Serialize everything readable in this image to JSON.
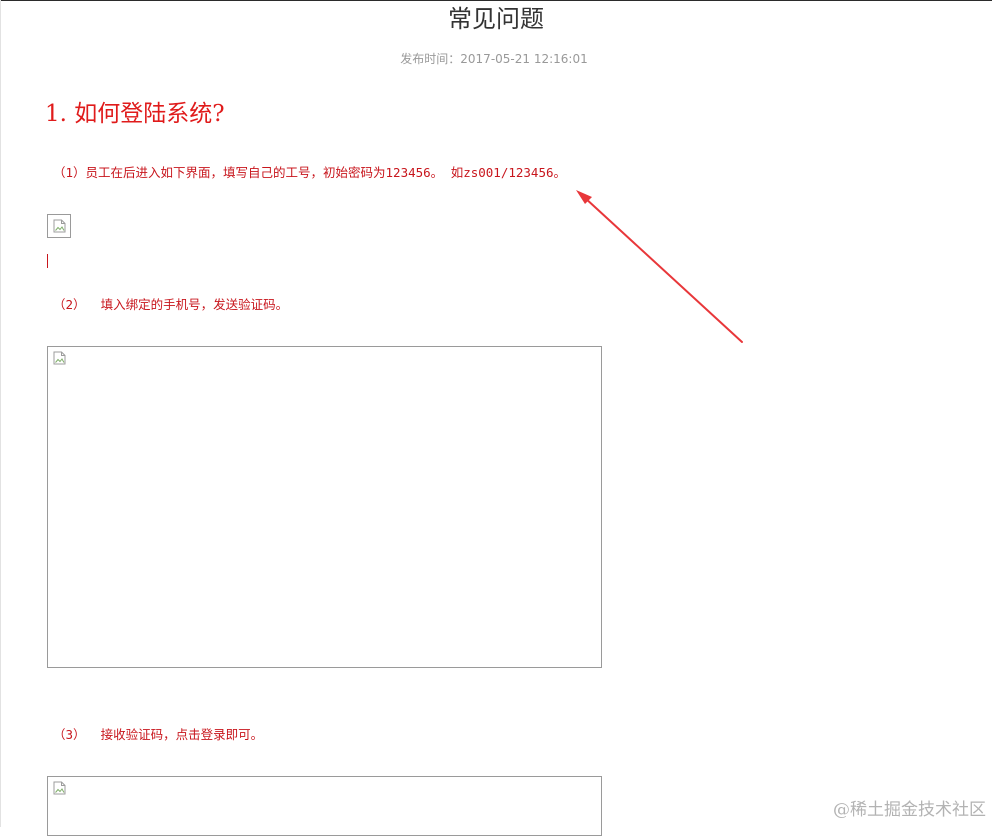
{
  "page": {
    "title": "常见问题",
    "publish_label": "发布时间：",
    "publish_time": "2017-05-21 12:16:01"
  },
  "section": {
    "heading": "1. 如何登陆系统?"
  },
  "steps": [
    {
      "text": "（1）员工在后进入如下界面，填写自己的工号，初始密码为123456。 如zs001/123456。"
    },
    {
      "text": "（2）  填入绑定的手机号，发送验证码。"
    },
    {
      "text": "（3）  接收验证码，点击登录即可。"
    }
  ],
  "images": [
    {
      "icon": "broken-image-icon"
    },
    {
      "icon": "broken-image-icon"
    },
    {
      "icon": "broken-image-icon"
    }
  ],
  "annotation": {
    "color": "#e8373a",
    "icon": "arrow-icon"
  },
  "watermark": {
    "text": "@稀土掘金技术社区"
  },
  "colors": {
    "accent_red": "#c8161d",
    "heading_red": "#e01b1b",
    "title_text": "#333333",
    "meta_text": "#999999"
  }
}
